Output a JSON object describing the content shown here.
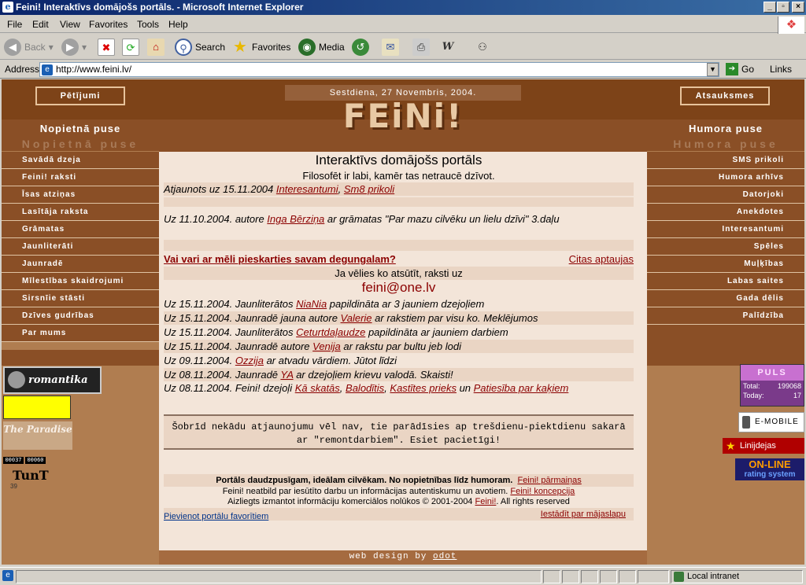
{
  "window": {
    "title": "Feini! Interaktīvs domājošs portāls. - Microsoft Internet Explorer"
  },
  "menu": [
    "File",
    "Edit",
    "View",
    "Favorites",
    "Tools",
    "Help"
  ],
  "toolbar": {
    "back": "Back",
    "search": "Search",
    "favorites": "Favorites",
    "media": "Media"
  },
  "address": {
    "label": "Address",
    "url": "http://www.feini.lv/",
    "go": "Go",
    "links": "Links"
  },
  "header": {
    "left_button": "Pētījumi",
    "right_button": "Atsauksmes",
    "date": "Sestdiena, 27 Novembris, 2004.",
    "logo": "FEiNi!"
  },
  "left_column": {
    "heading": "Nopietnā puse",
    "ghost": "Nopietnā puse",
    "items": [
      "Savādā dzeja",
      "Feini! raksti",
      "Īsas atziņas",
      "Lasītāja raksta",
      "Grāmatas",
      "Jaunliterāti",
      "Jaunradē",
      "Mīlestības skaidrojumi",
      "Sirsnīie stāsti",
      "Dzīves gudrības",
      "Par mums"
    ]
  },
  "right_column": {
    "heading": "Humora puse",
    "ghost": "Humora puse",
    "items": [
      "SMS prikoli",
      "Humora arhīvs",
      "Datorjoki",
      "Anekdotes",
      "Interesantumi",
      "Spēles",
      "Muļķības",
      "Labas saites",
      "Gada dēlis",
      "Palīdzība"
    ]
  },
  "main": {
    "title": "Interaktīvs domājošs portāls",
    "subtitle": "Filosofēt ir labi, kamēr tas netraucē dzīvot.",
    "update1_prefix": "Atjaunots uz 15.11.2004 ",
    "update1_link1": "Interesantumi",
    "update1_sep": ", ",
    "update1_link2": "Sm8 prikoli",
    "update2_prefix": "Uz 11.10.2004. autore ",
    "update2_link": "Inga Bērziņa",
    "update2_suffix": " ar grāmatas \"Par mazu cilvēku un lielu dzīvi\" 3.daļu",
    "poll_question": "Vai vari ar mēli pieskarties savam degungalam?",
    "poll_other": "Citas aptaujas",
    "contact_text": "Ja vēlies ko atsūtīt, raksti uz",
    "email": "feini@one.lv",
    "news": [
      {
        "pre": "Uz 15.11.2004. Jaunliterātos ",
        "link": "NiaNia",
        "post": " papildināta ar 3 jauniem dzejoļiem"
      },
      {
        "pre": "Uz 15.11.2004. Jaunradē jauna autore ",
        "link": "Valerie",
        "post": " ar rakstiem par visu ko. Meklējumos"
      },
      {
        "pre": "Uz 15.11.2004. Jaunliterātos ",
        "link": "Ceturtdaļaudze",
        "post": " papildināta ar jauniem darbiem"
      },
      {
        "pre": "Uz 15.11.2004. Jaunradē autore ",
        "link": "Venija",
        "post": " ar rakstu par bultu jeb lodi"
      },
      {
        "pre": "Uz 09.11.2004. ",
        "link": "Ozzija",
        "post": " ar atvadu vārdiem. Jūtot līdzi"
      },
      {
        "pre": "Uz 08.11.2004. Jaunradē ",
        "link": "YA",
        "post": " ar dzejoļiem krievu valodā. Skaisti!"
      }
    ],
    "last_news_pre": "Uz 08.11.2004. Feini! dzejoļi ",
    "last_news_l1": "Kā skatās",
    "last_news_l2": "Balodītis",
    "last_news_l3": "Kastītes prieks",
    "last_news_un": " un ",
    "last_news_l4": "Patiesība par kaķiem",
    "notice": "Šobrīd nekādu atjaunojumu vēl nav, tie parādīsies ap trešdienu-piektdienu sakarā ar \"remontdarbiem\". Esiet pacietīgi!",
    "footer1": "Portāls daudzpusīgam, ideālam cilvēkam. No nopietnības līdz humoram.",
    "footer1_link": "Feini! pārmaiņas",
    "footer2": "Feini! neatbild par iesūtīto darbu un informācijas autentiskumu un avotiem.",
    "footer2_link": "Feini! koncepcija",
    "footer3": "Aizliegts izmantot informāciju komerciālos nolūkos © 2001-2004 ",
    "footer3_link": "Feini!",
    "footer3_end": ". All rights reserved",
    "add_fav": "Pievienot portālu favorītiem",
    "set_home": "Iestādīt par mājaslapu",
    "webdesign": "web design by ",
    "webdesign_link": "odot"
  },
  "left_badges": {
    "romantika": "romantika",
    "paradise": "The Paradise",
    "counter1": "00037",
    "counter2": "00060",
    "tunt": "TunT",
    "tunt_nums": "39"
  },
  "right_badges": {
    "puls": "PULS",
    "total_label": "Total:",
    "total_value": "199068",
    "today_label": "Today:",
    "today_value": "17",
    "emobile": "E-MOBILE",
    "linijdejas": "Linijdejas",
    "online": "ON-LINE",
    "rating": "rating system"
  },
  "status": {
    "zone": "Local intranet"
  }
}
